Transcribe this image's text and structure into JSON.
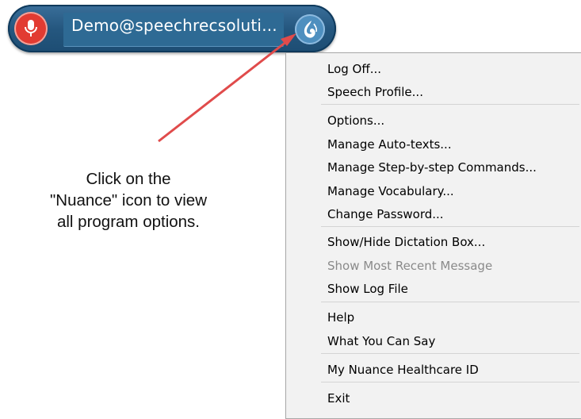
{
  "toolbar": {
    "username": "Demo@speechrecsoluti...",
    "mic_icon": "microphone-icon",
    "nuance_icon": "dragon-flame-icon",
    "colors": {
      "bar": "#25577f",
      "mic": "#e23b32",
      "nuance": "#4e8fbf"
    }
  },
  "instruction": {
    "line1": "Click on the",
    "line2": "\"Nuance\" icon to view",
    "line3": "all program options."
  },
  "menu": {
    "items": [
      {
        "label": "Log Off...",
        "enabled": true
      },
      {
        "label": "Speech Profile...",
        "enabled": true
      },
      {
        "label": "Options...",
        "enabled": true
      },
      {
        "label": "Manage Auto-texts...",
        "enabled": true
      },
      {
        "label": "Manage Step-by-step Commands...",
        "enabled": true
      },
      {
        "label": "Manage Vocabulary...",
        "enabled": true
      },
      {
        "label": "Change Password...",
        "enabled": true
      },
      {
        "label": "Show/Hide Dictation Box...",
        "enabled": true
      },
      {
        "label": "Show Most Recent Message",
        "enabled": false
      },
      {
        "label": "Show Log File",
        "enabled": true
      },
      {
        "label": "Help",
        "enabled": true
      },
      {
        "label": "What You Can Say",
        "enabled": true
      },
      {
        "label": "My Nuance Healthcare ID",
        "enabled": true
      },
      {
        "label": "Exit",
        "enabled": true
      }
    ]
  },
  "annotation_arrow_color": "#e04b4b"
}
